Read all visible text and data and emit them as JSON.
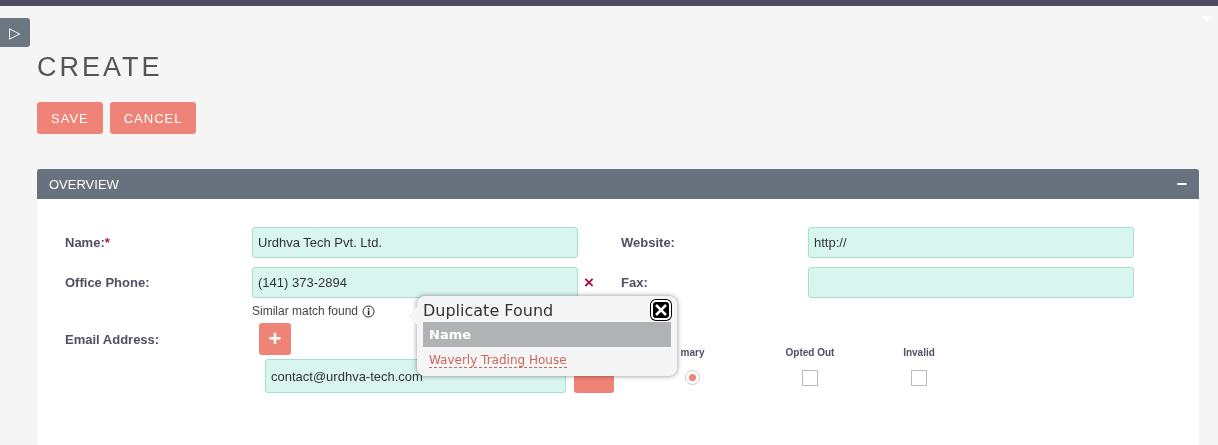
{
  "sidebar_toggle": {
    "glyph": "▷"
  },
  "title": "CREATE",
  "buttons": [
    "SAVE",
    "CANCEL"
  ],
  "panel": {
    "title": "OVERVIEW",
    "collapse_glyph": "−",
    "expanded": true
  },
  "fields": [
    {
      "label": "Name:",
      "required_mark": "*",
      "value": "Urdhva Tech Pvt. Ltd."
    },
    {
      "label": "Website:",
      "value": "http://"
    },
    {
      "label": "Office Phone:",
      "value": "(141) 373-2894",
      "clear_glyph": "×",
      "hint": "Similar match found"
    },
    {
      "label": "Fax:"
    }
  ],
  "email": {
    "label": "Email Address:",
    "add_glyph": "+",
    "value": "contact@urdhva-tech.com",
    "options": [
      {
        "label": "mary",
        "kind": "radio",
        "checked": true
      },
      {
        "label": "Opted Out",
        "kind": "checkbox",
        "checked": false
      },
      {
        "label": "Invalid",
        "kind": "checkbox",
        "checked": false
      }
    ]
  },
  "popup": {
    "title": "Duplicate Found",
    "column": "Name",
    "rows": [
      "Waverly Trading House"
    ]
  }
}
